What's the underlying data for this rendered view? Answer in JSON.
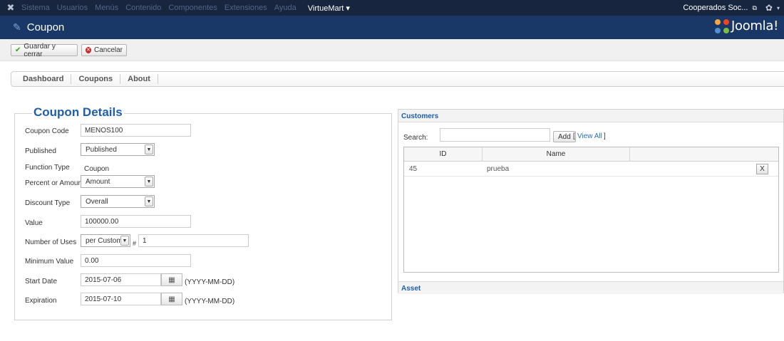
{
  "topbar": {
    "menu": [
      "Sistema",
      "Usuarios",
      "Menús",
      "Contenido",
      "Componentes",
      "Extensiones",
      "Ayuda"
    ],
    "virtuemart": "VirtueMart ▾",
    "user": "Cooperados Soc...",
    "external_icon": "external-link-icon",
    "gear_icon": "gear-icon"
  },
  "titlebar": {
    "title": "Coupon",
    "logo_text": "Joomla!"
  },
  "toolbar": {
    "save_close": "Guardar y cerrar",
    "cancel": "Cancelar"
  },
  "subtabs": [
    "Dashboard",
    "Coupons",
    "About"
  ],
  "details": {
    "legend": "Coupon Details",
    "coupon_code_label": "Coupon Code",
    "coupon_code_value": "MENOS100",
    "published_label": "Published",
    "published_value": "Published",
    "function_type_label": "Function Type",
    "function_type_value": "Coupon",
    "percent_amount_label": "Percent or Amount",
    "percent_amount_value": "Amount",
    "discount_type_label": "Discount Type",
    "discount_type_value": "Overall",
    "value_label": "Value",
    "value_value": "100000.00",
    "uses_label": "Number of Uses",
    "uses_select_value": "per Custom",
    "uses_hash": "#",
    "uses_value": "1",
    "min_value_label": "Minimum Value",
    "min_value_value": "0.00",
    "start_date_label": "Start Date",
    "start_date_value": "2015-07-06",
    "expiration_label": "Expiration",
    "expiration_value": "2015-07-10",
    "date_format": "(YYYY-MM-DD)"
  },
  "customers": {
    "header": "Customers",
    "search_label": "Search:",
    "add_button": "Add",
    "view_all_open": "[",
    "view_all": "View All",
    "view_all_close": "]",
    "columns": [
      "ID",
      "Name"
    ],
    "rows": [
      {
        "id": "45",
        "name": "prueba",
        "remove": "X"
      }
    ],
    "asset": "Asset"
  }
}
